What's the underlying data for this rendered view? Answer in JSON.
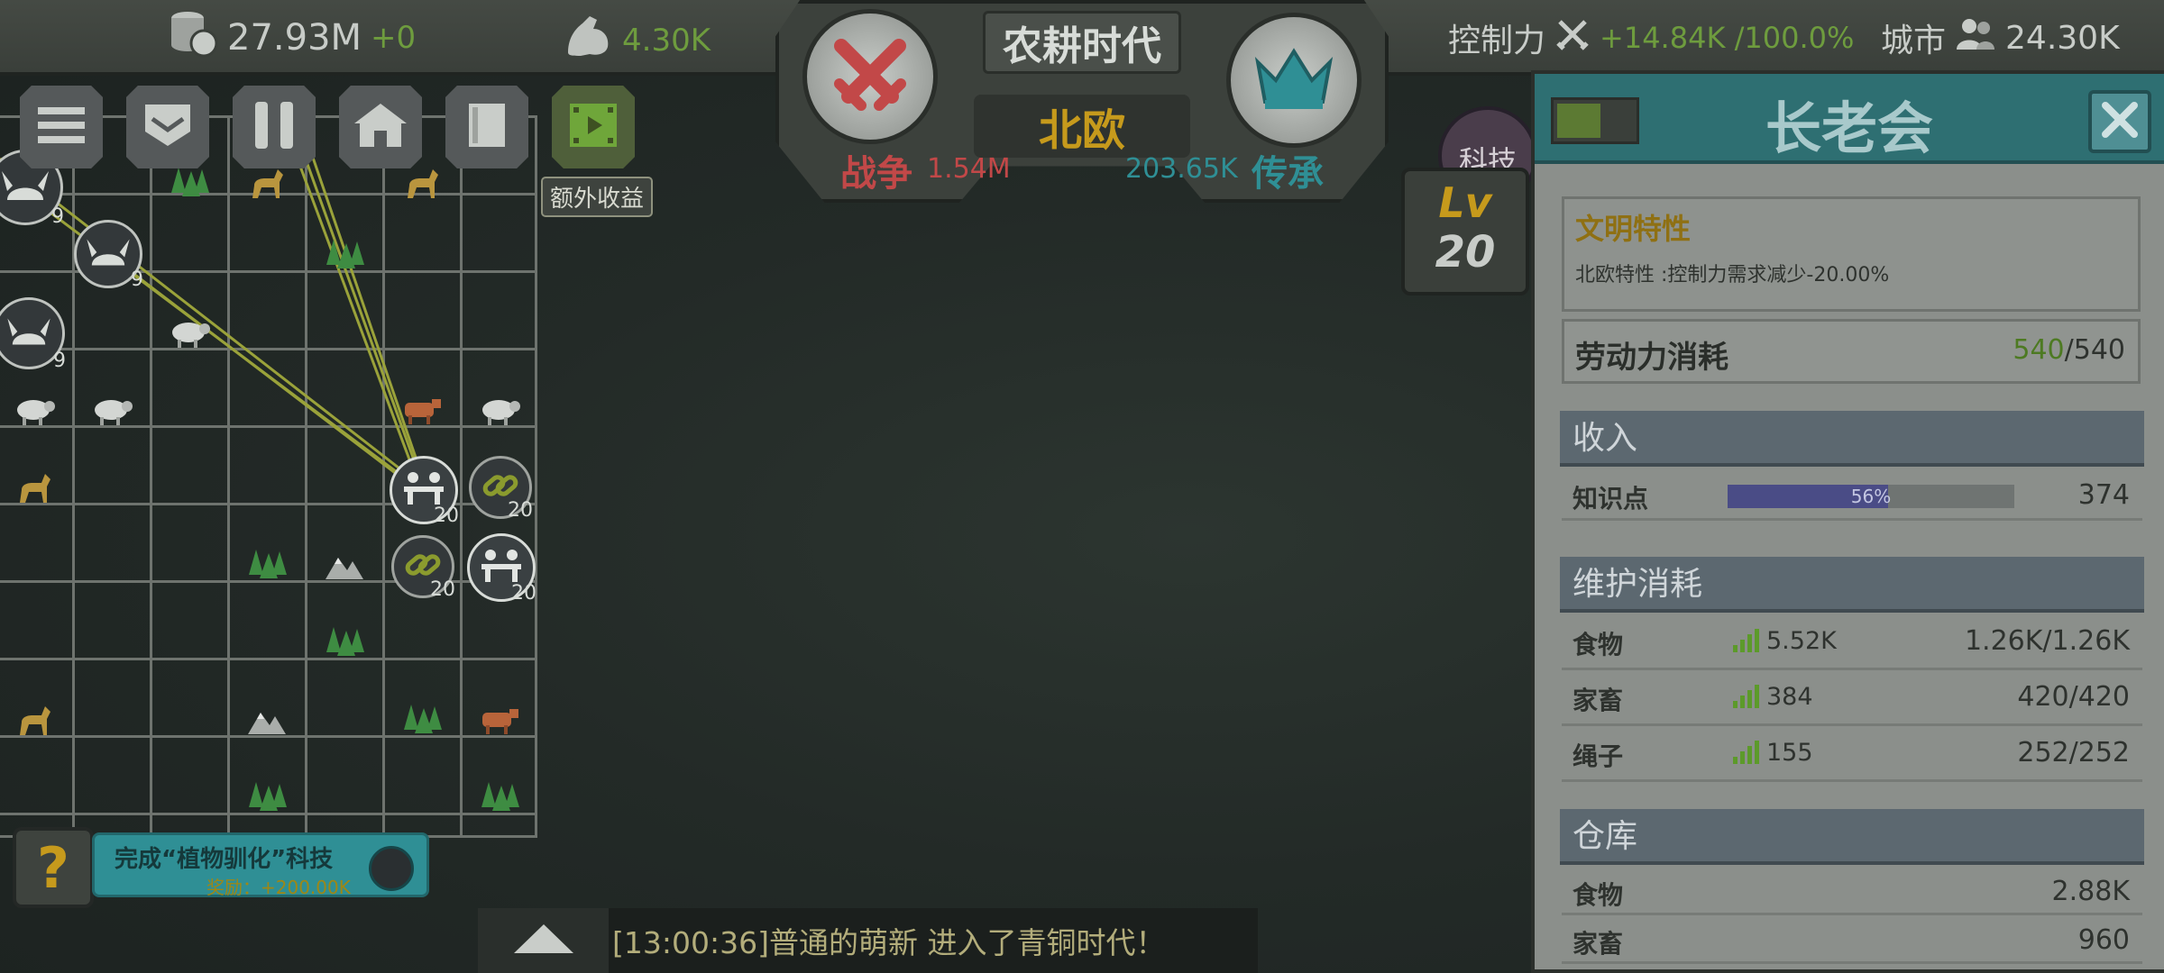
{
  "topbar": {
    "coins": "27.93M",
    "coins_delta": "+0",
    "strength": "4.30K",
    "control_label": "控制力",
    "control_value": "+14.84K /100.0%",
    "city_label": "城市",
    "city_value": "24.30K"
  },
  "emblem": {
    "era": "农耕时代",
    "civilization": "北欧",
    "war_label": "战争",
    "war_value": "1.54M",
    "legacy_label": "传承",
    "legacy_value": "203.65K"
  },
  "toolbar": {
    "extra_income_label": "额外收益",
    "buttons": [
      "menu-icon",
      "shield-icon",
      "pause-icon",
      "house-icon",
      "book-icon",
      "video-icon"
    ]
  },
  "map": {
    "tiles": [
      {
        "icon": "viking-helmet-icon",
        "lvl": "9"
      },
      {
        "icon": "tree-icon"
      },
      {
        "icon": "horse-icon"
      },
      {
        "icon": "horse-icon"
      },
      {
        "icon": "viking-helmet-icon",
        "lvl": "9"
      },
      {
        "icon": "tree-icon"
      },
      {
        "icon": "viking-helmet-icon",
        "lvl": "9"
      },
      {
        "icon": "sheep-icon"
      },
      {
        "icon": "sheep-icon"
      },
      {
        "icon": "sheep-icon"
      },
      {
        "icon": "cow-icon"
      },
      {
        "icon": "sheep-icon"
      },
      {
        "icon": "horse-icon"
      },
      {
        "icon": "council-icon",
        "lvl": "20"
      },
      {
        "icon": "chain-icon",
        "lvl": "20"
      },
      {
        "icon": "tree-icon"
      },
      {
        "icon": "mountain-icon"
      },
      {
        "icon": "chain-icon",
        "lvl": "20"
      },
      {
        "icon": "council-icon",
        "lvl": "20"
      },
      {
        "icon": "tree-icon"
      },
      {
        "icon": "horse-icon"
      },
      {
        "icon": "mountain-icon"
      },
      {
        "icon": "tree-icon"
      },
      {
        "icon": "cow-icon"
      },
      {
        "icon": "tree-icon"
      },
      {
        "icon": "tree-icon"
      }
    ]
  },
  "quest": {
    "title": "完成“植物驯化”科技",
    "reward": "奖励：+200.00K"
  },
  "chat": {
    "message": "[13:00:36]普通的萌新 进入了青铜时代！"
  },
  "side": {
    "tech_label": "科技",
    "lv_label": "Lv",
    "lv_value": "20"
  },
  "panel": {
    "title": "长老会",
    "trait_title": "文明特性",
    "trait_desc": "北欧特性 :控制力需求减少-20.00%",
    "labor_label": "劳动力消耗",
    "labor_used": "540",
    "labor_sep": "/",
    "labor_total": "540",
    "income_head": "收入",
    "knowledge_label": "知识点",
    "knowledge_progress": 0.56,
    "knowledge_pct": "56%",
    "knowledge_value": "374",
    "upkeep_head": "维护消耗",
    "upkeep": [
      {
        "name": "食物",
        "stock": "5.52K",
        "value": "1.26K/1.26K"
      },
      {
        "name": "家畜",
        "stock": "384",
        "value": "420/420"
      },
      {
        "name": "绳子",
        "stock": "155",
        "value": "252/252"
      }
    ],
    "storage_head": "仓库",
    "storage": [
      {
        "name": "食物",
        "value": "2.88K"
      },
      {
        "name": "家畜",
        "value": "960"
      }
    ]
  },
  "colors": {
    "gold": "#c69a1c",
    "teal": "#2e6f72",
    "war_red": "#c24848",
    "legacy_teal": "#2f8f95",
    "positive_green": "#6e9c3e"
  }
}
